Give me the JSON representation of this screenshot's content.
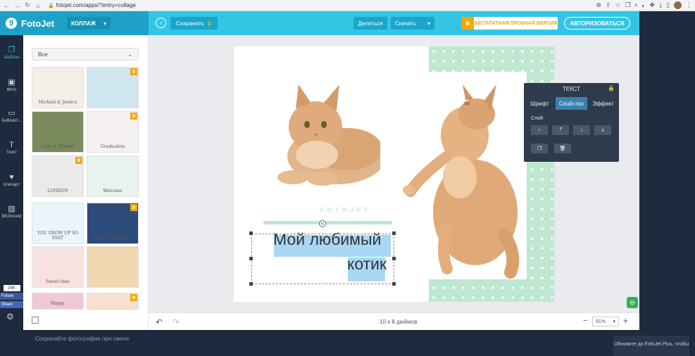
{
  "browser": {
    "url": "fotojet.com/apps/?entry=collage"
  },
  "header": {
    "logo": "FotoJet",
    "mode": "КОЛЛАЖ",
    "save": "Сохранить",
    "share": "Делиться",
    "download": "Скачать",
    "trial": "БЕСПЛАТНАЯ ПРОБНАЯ ВЕРСИЯ",
    "login": "АВТОРИЗОВАТЬСЯ"
  },
  "sidebar": {
    "items": [
      {
        "label": "Шаблон",
        "icon": "template-icon"
      },
      {
        "label": "Фото",
        "icon": "photo-icon"
      },
      {
        "label": "Библиот...",
        "icon": "library-icon"
      },
      {
        "label": "Текст",
        "icon": "text-icon"
      },
      {
        "label": "Клипарт",
        "icon": "clipart-icon"
      },
      {
        "label": "BKGround",
        "icon": "background-icon"
      }
    ],
    "like_count": "29K",
    "follow": "Follow",
    "share": "Share"
  },
  "panel": {
    "filter": "Все",
    "thumbs": [
      {
        "title": "Michael & Jessica",
        "color": "#f4efe6"
      },
      {
        "title": "",
        "color": "#cfe6ee"
      },
      {
        "title": "Love & Thanks",
        "color": "#7a8a5c"
      },
      {
        "title": "Graduation",
        "color": "#f6f1f1"
      },
      {
        "title": "LONDON",
        "color": "#eaeaea"
      },
      {
        "title": "Welcome",
        "color": "#e9f3ee"
      },
      {
        "title": "YOU GROW UP SO FAST",
        "color": "#e9f4fb"
      },
      {
        "title": "MILLY & BOBBY",
        "color": "#2d4b7a"
      },
      {
        "title": "Sweet time",
        "color": "#f7e1e1"
      },
      {
        "title": "",
        "color": "#f0d7b2"
      },
      {
        "title": "Happy",
        "color": "#f1c9d6"
      },
      {
        "title": "",
        "color": "#f7e0d0"
      }
    ]
  },
  "canvas": {
    "brand": "FOTOJET",
    "caption_line1": "Мой любимый",
    "caption_line2": "котик"
  },
  "text_panel": {
    "title": "ТЕКСТ",
    "tabs": [
      "Шрифт",
      "Свойство",
      "Эффект"
    ],
    "active_tab": "Свойство",
    "layer_label": "Слой"
  },
  "bottom": {
    "size": "10 x 8 дюймов",
    "zoom": "91%"
  },
  "footer": {
    "hint": "Сохраняйте фотографии при смене",
    "upgrade": "Обновите до FotoJet Plus, чтобы"
  }
}
